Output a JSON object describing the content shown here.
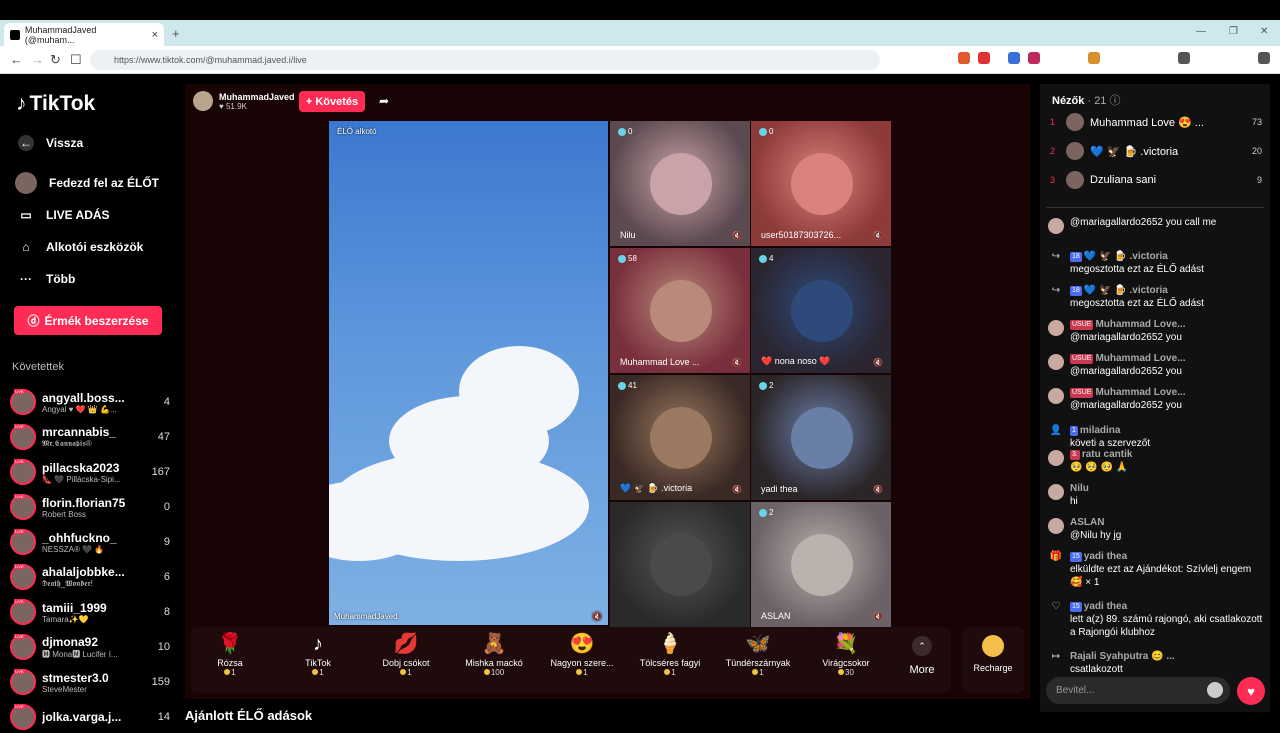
{
  "browser": {
    "tab_title": "MuhammadJaved (@muham...",
    "url": "https://www.tiktok.com/@muhammad.javed.i/live"
  },
  "sidebar": {
    "logo": "TikTok",
    "back": "Vissza",
    "explore": "Fedezd fel az ÉLŐT",
    "live": "LIVE ADÁS",
    "creator_tools": "Alkotói eszközök",
    "more": "Több",
    "coins_button": "Érmék beszerzése",
    "following_header": "Követettek",
    "following": [
      {
        "name": "angyall.boss...",
        "sub": "Angyal ♥ ❤️ 👑 💪...",
        "count": "4"
      },
      {
        "name": "mrcannabis_",
        "sub": "𝕸𝖗.𝕮𝖆𝖓𝖓𝖆𝖇𝖎𝖘®",
        "count": "47"
      },
      {
        "name": "pillacska2023",
        "sub": "👠 🖤 Pillácska-Sipi...",
        "count": "167"
      },
      {
        "name": "florin.florian75",
        "sub": "Robert Boss",
        "count": "0"
      },
      {
        "name": "_ohhfuckno_",
        "sub": "NESSZA® 🖤 🔥",
        "count": "9"
      },
      {
        "name": "ahalaljobbke...",
        "sub": "𝕯𝖊𝖆𝖙𝖍_𝖂𝖔𝖓𝖉𝖊𝖗!",
        "count": "6"
      },
      {
        "name": "tamiii_1999",
        "sub": "Tamara✨💛",
        "count": "8"
      },
      {
        "name": "djmona92",
        "sub": "🅼 Mona🅼 Lucifer I...",
        "count": "10"
      },
      {
        "name": "stmester3.0",
        "sub": "SteveMester",
        "count": "159"
      },
      {
        "name": "jolka.varga.j...",
        "sub": "",
        "count": "14"
      }
    ]
  },
  "stream": {
    "host_name": "MuhammadJaved",
    "host_likes": "♥ 51.9K",
    "follow_label": "+ Követés",
    "main_label": "ÉLŐ alkotó",
    "main_name": "MuhammadJaved",
    "guests": [
      {
        "count": "0",
        "name": "Nilu",
        "bg": "#5b4a50",
        "av": "#caa3a8"
      },
      {
        "count": "0",
        "name": "user50187303726...",
        "bg": "#8d3a3a",
        "av": "#d9837c"
      },
      {
        "count": "58",
        "name": "Muhammad Love ...",
        "bg": "#7a2f3c",
        "av": "#b98a7c"
      },
      {
        "count": "4",
        "name": "❤️ nona noso ❤️",
        "bg": "#2a2530",
        "av": "#2e4a7a"
      },
      {
        "count": "41",
        "name": "💙 🦅 🍺 .victoria",
        "bg": "#3a2a25",
        "av": "#9b7860"
      },
      {
        "count": "2",
        "name": "yadi thea",
        "bg": "#2b2528",
        "av": "#6a7fa8"
      },
      {
        "count": "",
        "name": "",
        "bg": "#2a2a2a",
        "av": "#555555"
      },
      {
        "count": "2",
        "name": "ASLAN",
        "bg": "#6a6266",
        "av": "#b9b2ad"
      }
    ]
  },
  "gifts": [
    {
      "icon": "🌹",
      "name": "Rózsa",
      "price": "1"
    },
    {
      "icon": "♪",
      "name": "TikTok",
      "price": "1"
    },
    {
      "icon": "💋",
      "name": "Dobj csókot",
      "price": "1"
    },
    {
      "icon": "🧸",
      "name": "Mishka mackó",
      "price": "100"
    },
    {
      "icon": "😍",
      "name": "Nagyon szere...",
      "price": "1"
    },
    {
      "icon": "🍦",
      "name": "Tölcséres fagyi",
      "price": "1"
    },
    {
      "icon": "🦋",
      "name": "Tündérszárnyak",
      "price": "1"
    },
    {
      "icon": "💐",
      "name": "Virágcsokor",
      "price": "30"
    }
  ],
  "gift_more": "More",
  "recharge": "Recharge",
  "recommended": "Ajánlott ÉLŐ adások",
  "panel": {
    "viewers_title": "Nézők",
    "viewers_count": "· 21",
    "top": [
      {
        "rank": "1",
        "name": "Muhammad Love 😍 ...",
        "score": "73"
      },
      {
        "rank": "2",
        "name": "💙 🦅 🍺 .victoria",
        "score": "20"
      },
      {
        "rank": "3",
        "name": "Dzuliana sani",
        "score": "9"
      }
    ],
    "messages": [
      {
        "icon": "avatar",
        "user": "",
        "badge": "",
        "text": "@mariagallardo2652 you call me"
      },
      {
        "icon": "↪",
        "user": "💙 🦅 🍺 .victoria",
        "badge": "18",
        "text": "megosztotta ezt az ÉLŐ adást"
      },
      {
        "icon": "↪",
        "user": "💙 🦅 🍺 .victoria",
        "badge": "18",
        "text": "megosztotta ezt az ÉLŐ adást"
      },
      {
        "icon": "avatar",
        "user": "Muhammad Love...",
        "badge": "USUE",
        "text": "@mariagallardo2652 you"
      },
      {
        "icon": "avatar",
        "user": "Muhammad Love...",
        "badge": "USUE",
        "text": "@mariagallardo2652 you"
      },
      {
        "icon": "avatar",
        "user": "Muhammad Love...",
        "badge": "USUE",
        "text": "@mariagallardo2652 you"
      },
      {
        "icon": "👤",
        "user": "miladina",
        "badge": "1",
        "text": "követi a szervezőt"
      },
      {
        "icon": "avatar",
        "user": "ratu cantik",
        "badge": "3.",
        "text": "🥺 🥺 🥺 🙏"
      },
      {
        "icon": "avatar",
        "user": "Nilu",
        "badge": "",
        "text": "hi"
      },
      {
        "icon": "avatar",
        "user": "ASLAN",
        "badge": "",
        "text": "@Nilu hy jg"
      },
      {
        "icon": "🎁",
        "user": "yadi thea",
        "badge": "15",
        "text": "elküldte ezt az Ajándékot: Szívlelj engem 🥰 × 1"
      },
      {
        "icon": "♡",
        "user": "yadi thea",
        "badge": "15",
        "text": "lett a(z) 89. számú rajongó, aki csatlakozott a Rajongói klubhoz"
      },
      {
        "icon": "↦",
        "user": "Rajali Syahputra 😊 ...",
        "badge": "",
        "text": "csatlakozott"
      }
    ],
    "input_placeholder": "Bevitel..."
  }
}
